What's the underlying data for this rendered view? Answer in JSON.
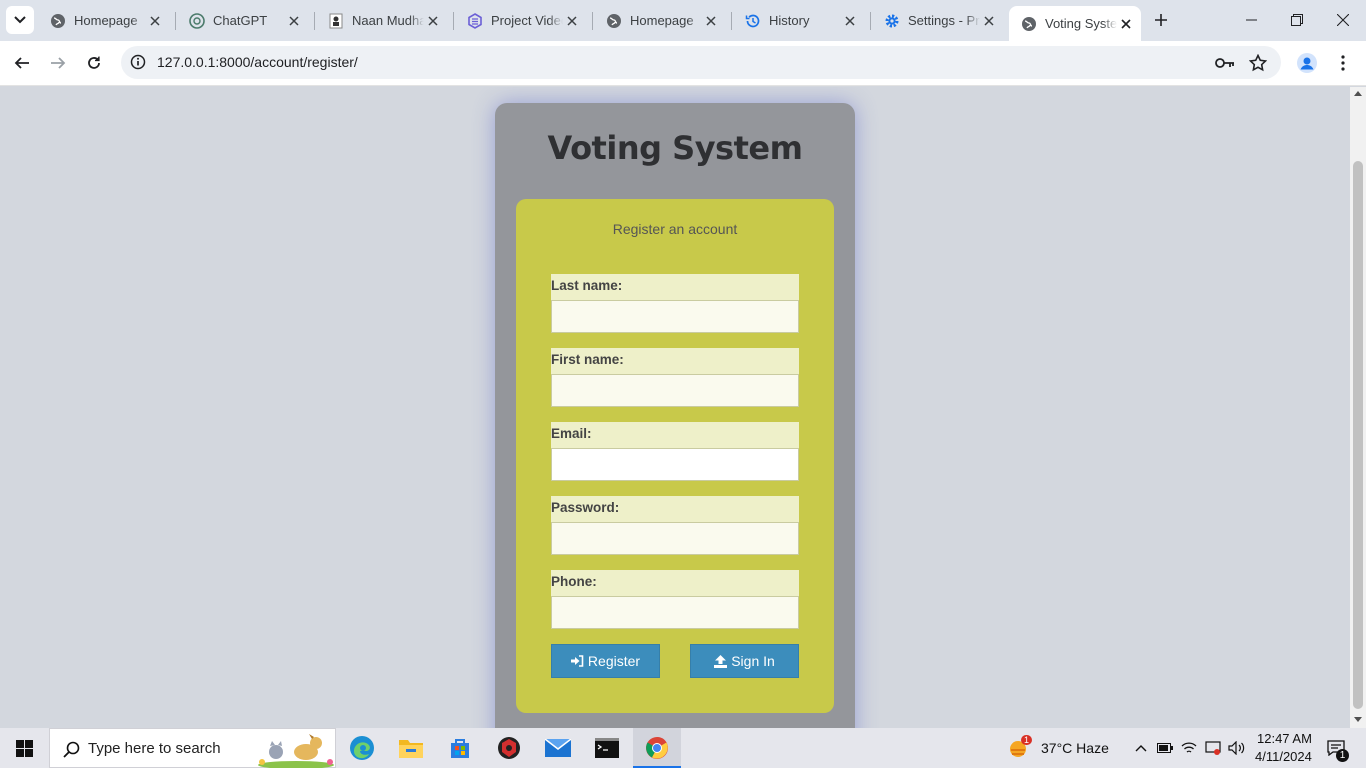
{
  "browser": {
    "tabs": [
      {
        "title": "Homepage",
        "icon": "globe-icon"
      },
      {
        "title": "ChatGPT",
        "icon": "chatgpt-icon"
      },
      {
        "title": "Naan Mudhalvan",
        "icon": "naan-mudhalvan-icon"
      },
      {
        "title": "Project Video",
        "icon": "project-icon"
      },
      {
        "title": "Homepage",
        "icon": "globe-icon"
      },
      {
        "title": "History",
        "icon": "history-icon"
      },
      {
        "title": "Settings - Privacy",
        "icon": "gear-icon"
      },
      {
        "title": "Voting System",
        "icon": "globe-icon",
        "active": true
      }
    ],
    "url": "127.0.0.1:8000/account/register/"
  },
  "page": {
    "heading": "Voting System",
    "subtitle": "Register an account",
    "fields": [
      {
        "label": "Last name:",
        "value": ""
      },
      {
        "label": "First name:",
        "value": ""
      },
      {
        "label": "Email:",
        "value": ""
      },
      {
        "label": "Password:",
        "value": ""
      },
      {
        "label": "Phone:",
        "value": ""
      }
    ],
    "register_label": "Register",
    "signin_label": "Sign In"
  },
  "taskbar": {
    "search_placeholder": "Type here to search",
    "weather": "37°C  Haze",
    "weather_badge": "1",
    "time": "12:47 AM",
    "date": "4/11/2024",
    "notification_count": "1"
  },
  "colors": {
    "card": "#94969b",
    "panel": "#c8c94a",
    "button": "#3c8dbc",
    "page_bg": "#d3d7de"
  }
}
